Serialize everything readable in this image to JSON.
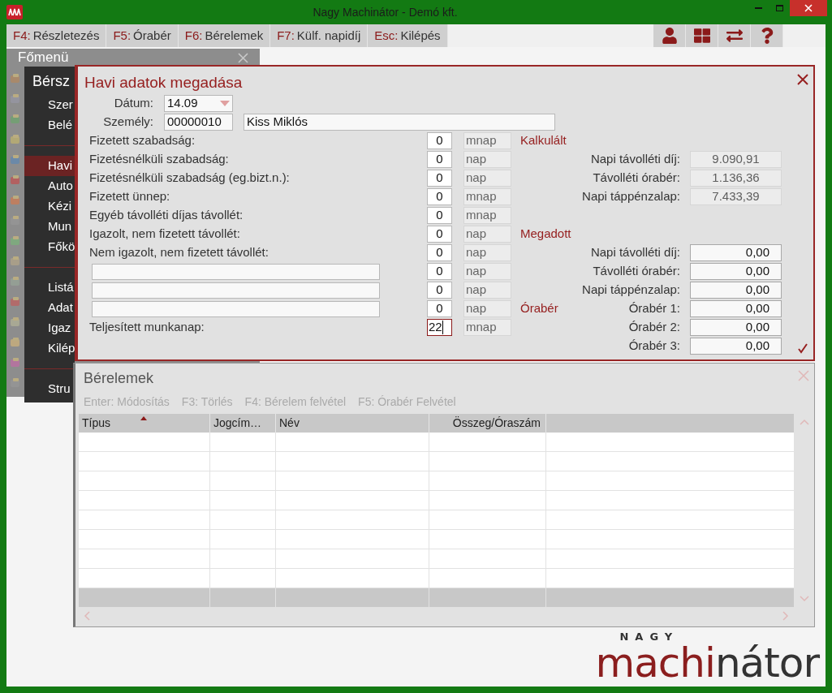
{
  "window": {
    "title": "Nagy Machinátor - Demó kft."
  },
  "toolbar": {
    "commands": [
      {
        "key": "F4:",
        "label": "Részletezés"
      },
      {
        "key": "F5:",
        "label": "Órabér"
      },
      {
        "key": "F6:",
        "label": "Bérelemek"
      },
      {
        "key": "F7:",
        "label": "Külf. napidíj"
      },
      {
        "key": "Esc:",
        "label": "Kilépés"
      }
    ]
  },
  "main_menu": {
    "title": "Főmenü",
    "section_title": "Bérsz",
    "groups": [
      {
        "items": [
          {
            "label": "Szer",
            "selected": false
          },
          {
            "label": "Belé",
            "selected": false
          }
        ]
      },
      {
        "items": [
          {
            "label": "Havi",
            "selected": true
          },
          {
            "label": "Auto",
            "selected": false
          },
          {
            "label": "Kézi",
            "selected": false
          },
          {
            "label": "Mun",
            "selected": false
          },
          {
            "label": "Főkö",
            "selected": false
          }
        ]
      },
      {
        "items": [
          {
            "label": "Listá",
            "selected": false
          },
          {
            "label": "Adat",
            "selected": false
          },
          {
            "label": "Igaz",
            "selected": false
          },
          {
            "label": "Kilép",
            "selected": false
          }
        ]
      },
      {
        "items": [
          {
            "label": "Stru",
            "selected": false
          }
        ]
      }
    ]
  },
  "dialog": {
    "title": "Havi adatok megadása",
    "date": {
      "label": "Dátum:",
      "value": "14.09"
    },
    "person": {
      "label": "Személy:",
      "code": "00000010",
      "name": "Kiss Miklós"
    },
    "rows": [
      {
        "kind": "label",
        "label": "Fizetett szabadság:",
        "value": "0",
        "unit": "mnap",
        "focused": false
      },
      {
        "kind": "label",
        "label": "Fizetésnélküli szabadság:",
        "value": "0",
        "unit": "nap",
        "focused": false
      },
      {
        "kind": "label",
        "label": "Fizetésnélküli szabadság (eg.bizt.n.):",
        "value": "0",
        "unit": "nap",
        "focused": false
      },
      {
        "kind": "label",
        "label": "Fizetett ünnep:",
        "value": "0",
        "unit": "mnap",
        "focused": false
      },
      {
        "kind": "label",
        "label": "Egyéb távolléti díjas távollét:",
        "value": "0",
        "unit": "mnap",
        "focused": false
      },
      {
        "kind": "label",
        "label": "Igazolt, nem fizetett távollét:",
        "value": "0",
        "unit": "nap",
        "focused": false
      },
      {
        "kind": "label",
        "label": "Nem igazolt, nem fizetett távollét:",
        "value": "0",
        "unit": "nap",
        "focused": false
      },
      {
        "kind": "input",
        "value": "0",
        "unit": "nap",
        "focused": false
      },
      {
        "kind": "input",
        "value": "0",
        "unit": "nap",
        "focused": false
      },
      {
        "kind": "input",
        "value": "0",
        "unit": "nap",
        "focused": false
      },
      {
        "kind": "label",
        "label": "Teljesített munkanap:",
        "value": "22",
        "unit": "mnap",
        "focused": true
      }
    ],
    "sections": [
      {
        "title": "Kalkulált",
        "kind": "stacked",
        "fields": [
          {
            "label": "Napi távolléti díj:",
            "value": "9.090,91",
            "editable": false
          },
          {
            "label": "Távolléti órabér:",
            "value": "1.136,36",
            "editable": false
          },
          {
            "label": "Napi táppénzalap:",
            "value": "7.433,39",
            "editable": false
          }
        ]
      },
      {
        "title": "Megadott",
        "kind": "stacked",
        "fields": [
          {
            "label": "Napi távolléti díj:",
            "value": "0,00",
            "editable": true
          },
          {
            "label": "Távolléti órabér:",
            "value": "0,00",
            "editable": true
          },
          {
            "label": "Napi táppénzalap:",
            "value": "0,00",
            "editable": true
          }
        ]
      },
      {
        "title": "Órabér",
        "kind": "inline",
        "fields": [
          {
            "label": "Órabér 1:",
            "value": "0,00",
            "editable": true
          },
          {
            "label": "Órabér 2:",
            "value": "0,00",
            "editable": true
          },
          {
            "label": "Órabér 3:",
            "value": "0,00",
            "editable": true
          }
        ]
      }
    ]
  },
  "wage_items": {
    "title": "Bérelemek",
    "commands": [
      "Enter: Módosítás",
      "F3: Törlés",
      "F4: Bérelem felvétel",
      "F5: Órabér Felvétel"
    ],
    "columns": [
      {
        "label": "Típus",
        "sorted": true
      },
      {
        "label": "Jogcím…",
        "sorted": false
      },
      {
        "label": "Név",
        "sorted": false
      },
      {
        "label": "Összeg/Óraszám",
        "sorted": false
      }
    ]
  },
  "logo": {
    "top": "NAGY",
    "part1": "machi",
    "part2": "nátor"
  }
}
